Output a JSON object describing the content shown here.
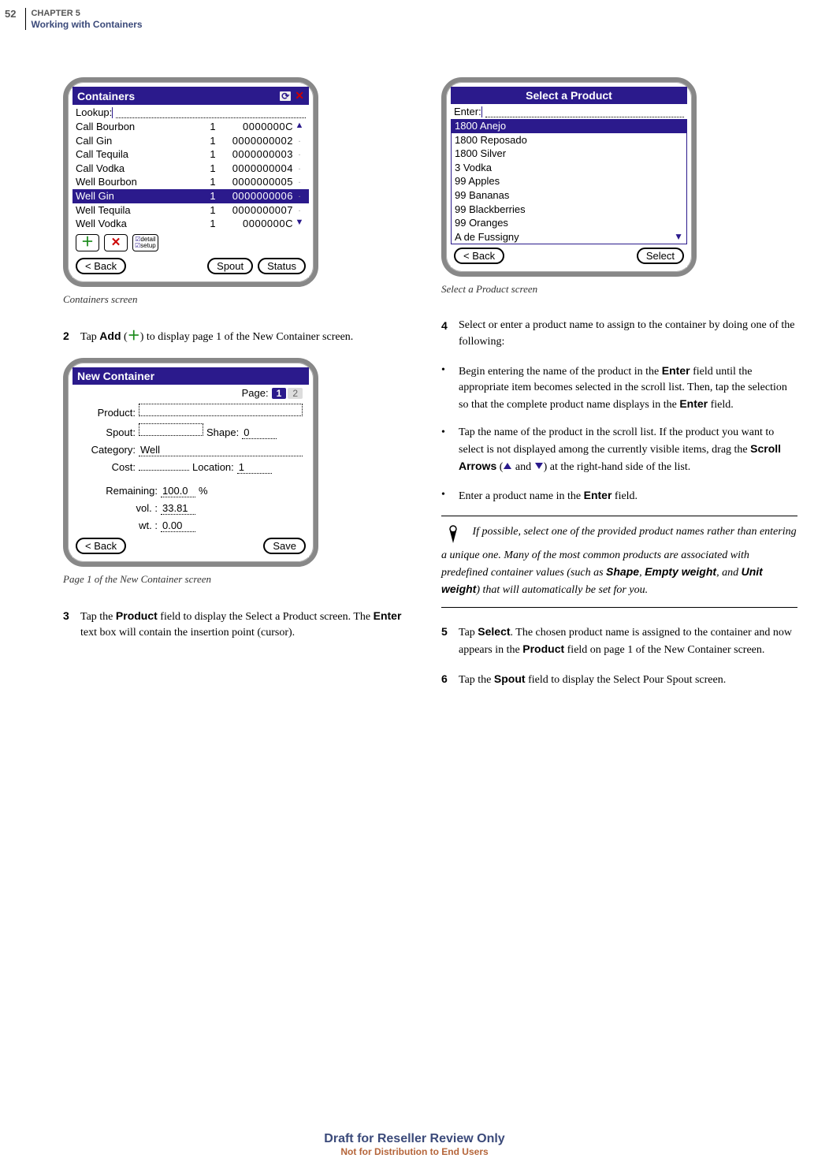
{
  "page_header": {
    "page_number": "52",
    "chapter_line1": "CHAPTER 5",
    "chapter_line2": "Working with Containers"
  },
  "captions": {
    "containers": "Containers screen",
    "new_container": "Page 1 of the New Container screen",
    "select_product": "Select a Product screen"
  },
  "steps": {
    "s2_a": "Tap ",
    "s2_b": "Add",
    "s2_c": " (",
    "s2_d": ") to display page 1 of the New Container screen.",
    "s3_a": "Tap the ",
    "s3_b": "Product",
    "s3_c": " field to display the Select a Product screen. The ",
    "s3_d": "Enter",
    "s3_e": " text box will contain the insertion point (cursor).",
    "s4": "Select or enter a product name to assign to the container by doing one of the following:",
    "b1_a": "Begin entering the name of the product in the ",
    "b1_b": "Enter",
    "b1_c": " field until the appropriate item becomes selected in the scroll list. Then, tap the selection so that the complete product name displays in the ",
    "b1_d": "Enter",
    "b1_e": " field.",
    "b2_a": "Tap the name of the product in the scroll list. If the product you want to select is not displayed among the currently visible items, drag the ",
    "b2_b": "Scroll Arrows",
    "b2_c": " (",
    "b2_d": " and ",
    "b2_e": ") at the right-hand side of the list.",
    "b3_a": "Enter a product name in the ",
    "b3_b": "Enter",
    "b3_c": " field.",
    "s5_a": "Tap ",
    "s5_b": "Select",
    "s5_c": ". The chosen product name is assigned to the container and now appears in the ",
    "s5_d": "Product",
    "s5_e": " field on page 1 of the New Container screen.",
    "s6_a": "Tap the ",
    "s6_b": "Spout",
    "s6_c": " field to display the Select Pour Spout screen."
  },
  "step_numbers": {
    "n2": "2",
    "n3": "3",
    "n4": "4",
    "n5": "5",
    "n6": "6"
  },
  "bullet": "•",
  "tip": {
    "text_a": "If possible, select one of the provided product names rather than entering a unique one. Many of the most common products are associated with predefined container values (such as ",
    "b1": "Shape",
    "sep1": ", ",
    "b2": "Empty weight",
    "sep2": ", and ",
    "b3": "Unit weight",
    "text_b": ") that will automatically be set for you."
  },
  "containers_screen": {
    "title": "Containers",
    "lookup_label": "Lookup:",
    "rows": [
      {
        "name": "Call Bourbon",
        "qty": "1",
        "code": "0000000C",
        "arrow": "up"
      },
      {
        "name": "Call Gin",
        "qty": "1",
        "code": "0000000002",
        "arrow": ""
      },
      {
        "name": "Call Tequila",
        "qty": "1",
        "code": "0000000003",
        "arrow": ""
      },
      {
        "name": "Call Vodka",
        "qty": "1",
        "code": "0000000004",
        "arrow": ""
      },
      {
        "name": "Well Bourbon",
        "qty": "1",
        "code": "0000000005",
        "arrow": ""
      },
      {
        "name": "Well Gin",
        "qty": "1",
        "code": "0000000006",
        "arrow": "",
        "selected": true
      },
      {
        "name": "Well Tequila",
        "qty": "1",
        "code": "0000000007",
        "arrow": ""
      },
      {
        "name": "Well Vodka",
        "qty": "1",
        "code": "0000000C",
        "arrow": "down"
      }
    ],
    "check_items": [
      "detail",
      "setup"
    ],
    "buttons": {
      "back": "< Back",
      "spout": "Spout",
      "status": "Status"
    }
  },
  "new_container_screen": {
    "title": "New Container",
    "page_label": "Page:",
    "pages": [
      "1",
      "2"
    ],
    "labels": {
      "product": "Product:",
      "spout": "Spout:",
      "shape": "Shape:",
      "category": "Category:",
      "cost": "Cost:",
      "location": "Location:",
      "remaining": "Remaining:",
      "vol": "vol. :",
      "wt": "wt. :"
    },
    "values": {
      "shape": "0",
      "category": "Well",
      "location": "1",
      "remaining": "100.0",
      "remaining_unit": "%",
      "vol": "33.81",
      "wt": "0.00"
    },
    "buttons": {
      "back": "< Back",
      "save": "Save"
    }
  },
  "select_product_screen": {
    "title": "Select a Product",
    "enter_label": "Enter:",
    "items": [
      {
        "name": "1800 Anejo",
        "selected": true
      },
      {
        "name": "1800 Reposado"
      },
      {
        "name": "1800 Silver"
      },
      {
        "name": "3 Vodka"
      },
      {
        "name": "99 Apples"
      },
      {
        "name": "99 Bananas"
      },
      {
        "name": "99 Blackberries"
      },
      {
        "name": "99 Oranges"
      },
      {
        "name": "A de Fussigny"
      }
    ],
    "buttons": {
      "back": "< Back",
      "select": "Select"
    }
  },
  "footer": {
    "line1": "Draft for Reseller Review Only",
    "line2": "Not for Distribution to End Users"
  }
}
